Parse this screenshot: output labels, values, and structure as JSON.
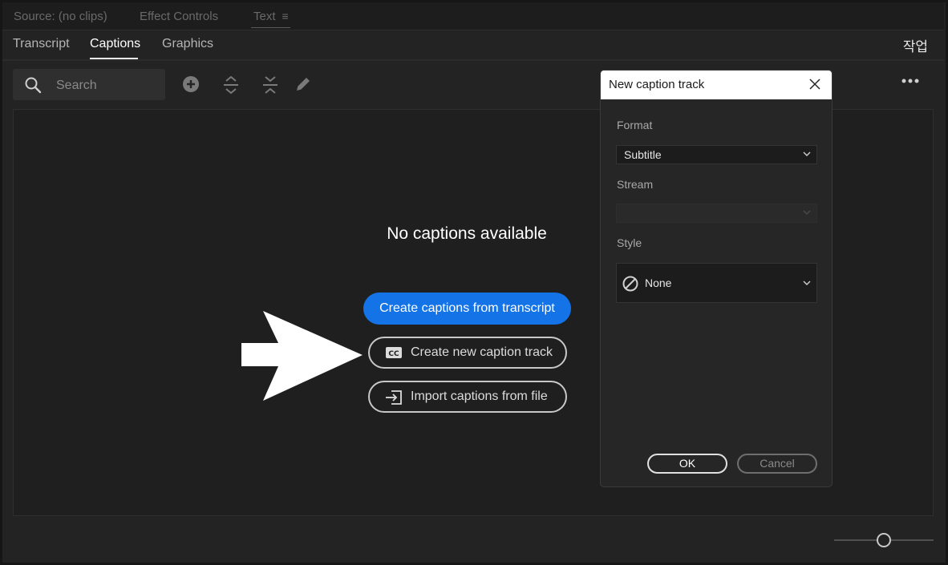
{
  "panel_tabs": [
    {
      "label": "Source: (no clips)"
    },
    {
      "label": "Effect Controls"
    },
    {
      "label": "Text"
    }
  ],
  "sub_tabs": [
    {
      "label": "Transcript"
    },
    {
      "label": "Captions"
    },
    {
      "label": "Graphics"
    }
  ],
  "active_sub_tab": "Captions",
  "workspace_label": "작업",
  "search": {
    "placeholder": "Search"
  },
  "toolbar_icons": [
    "add-icon",
    "expand-icon",
    "collapse-icon",
    "edit-icon",
    "more-icon"
  ],
  "main": {
    "empty_message": "No captions available",
    "primary_button": "Create captions from transcript",
    "new_track_button": "Create new caption track",
    "import_button": "Import captions from file"
  },
  "dialog": {
    "title": "New caption track",
    "format_label": "Format",
    "format_value": "Subtitle",
    "stream_label": "Stream",
    "stream_value": "",
    "style_label": "Style",
    "style_value": "None",
    "ok_label": "OK",
    "cancel_label": "Cancel"
  },
  "colors": {
    "accent": "#1473e6",
    "background": "#232323",
    "dialog_title_bg": "#ffffff"
  }
}
